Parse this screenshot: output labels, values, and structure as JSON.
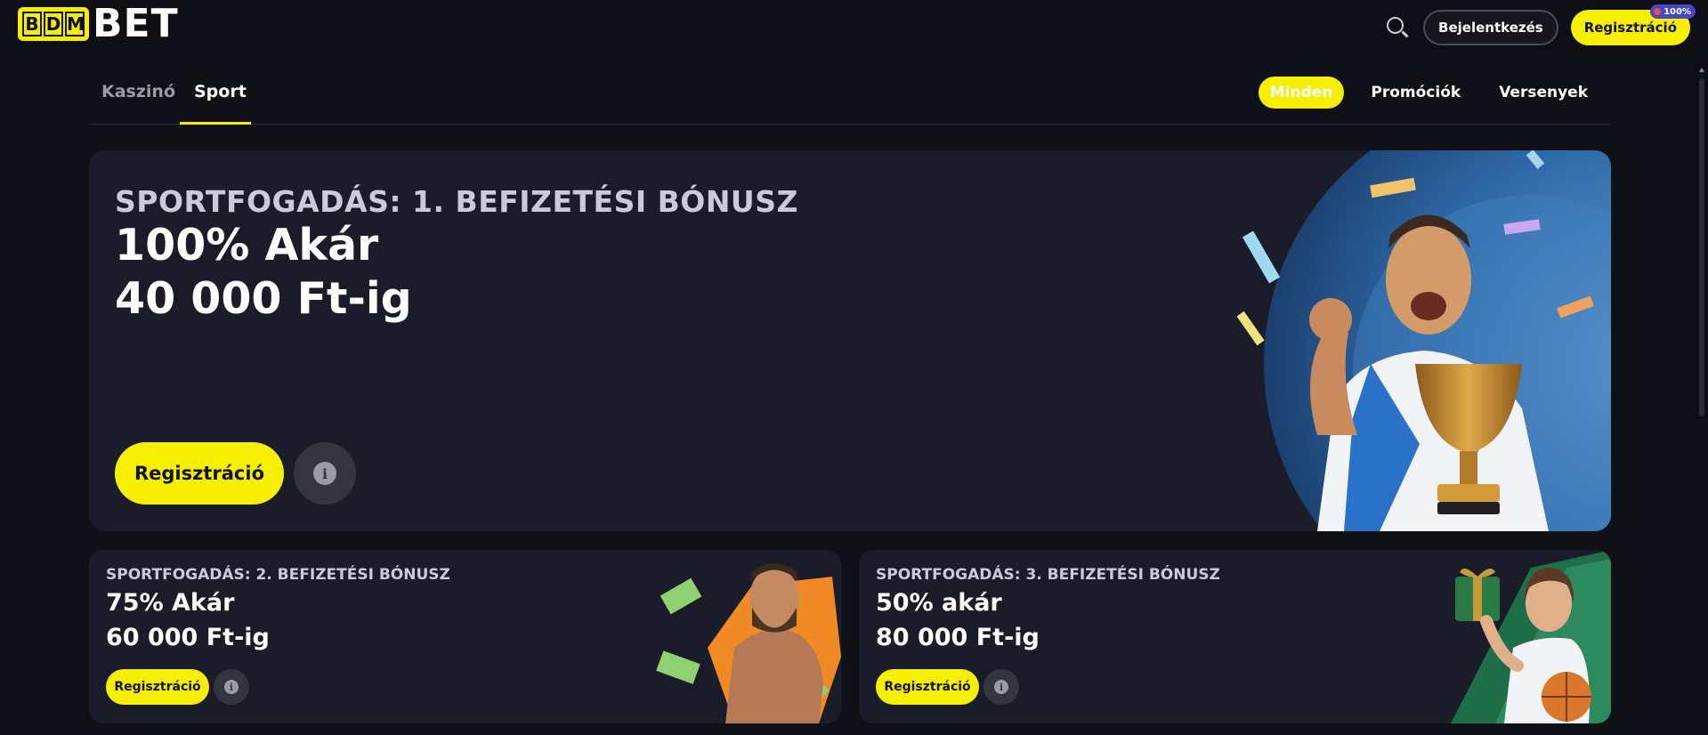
{
  "header": {
    "logo_letters": [
      "B",
      "D",
      "M"
    ],
    "logo_word": "BET",
    "login_label": "Bejelentkezés",
    "register_label": "Regisztráció",
    "register_badge": "100%"
  },
  "subnav": {
    "tabs": [
      {
        "label": "Kaszinó",
        "active": false
      },
      {
        "label": "Sport",
        "active": true
      }
    ],
    "filters": [
      {
        "label": "Minden",
        "active": true
      },
      {
        "label": "Promóciók",
        "active": false
      },
      {
        "label": "Versenyek",
        "active": false
      }
    ]
  },
  "hero": {
    "kicker": "SPORTFOGADÁS: 1. BEFIZETÉSI BÓNUSZ",
    "line1": "100% Akár",
    "line2": "40 000 Ft-ig",
    "button": "Regisztráció",
    "info_icon": "i"
  },
  "cards": [
    {
      "kicker": "SPORTFOGADÁS: 2. BEFIZETÉSI BÓNUSZ",
      "line1": "75% Akár",
      "line2": "60 000 Ft-ig",
      "button": "Regisztráció",
      "info_icon": "i"
    },
    {
      "kicker": "SPORTFOGADÁS: 3. BEFIZETÉSI BÓNUSZ",
      "line1": "50% akár",
      "line2": "80 000 Ft-ig",
      "button": "Regisztráció",
      "info_icon": "i"
    }
  ],
  "colors": {
    "accent": "#f6f000",
    "background": "#101117",
    "card": "#1b1c2a",
    "badge": "#4447c9"
  }
}
